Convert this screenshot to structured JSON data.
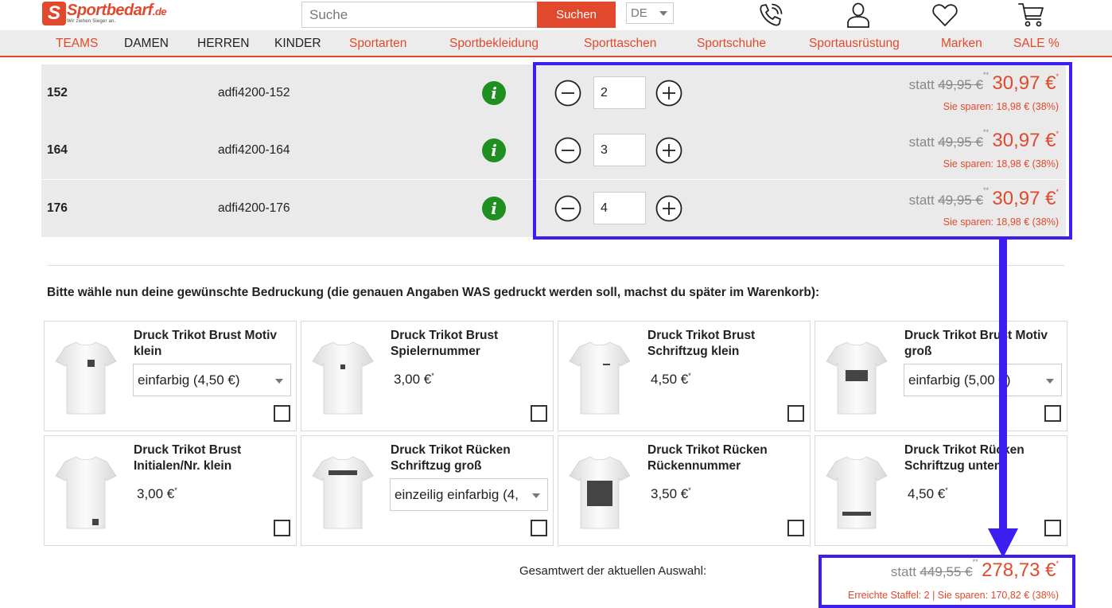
{
  "header": {
    "logo": {
      "name": "Sportbedarf",
      "tld": ".de",
      "slogan": "Wir ziehen Sieger an."
    },
    "search": {
      "placeholder": "Suche",
      "button": "Suchen"
    },
    "language": "DE",
    "icons": [
      "phone-icon",
      "user-icon",
      "heart-icon",
      "cart-icon"
    ]
  },
  "nav": [
    {
      "label": "TEAMS",
      "style": "red"
    },
    {
      "label": "DAMEN",
      "style": "dark"
    },
    {
      "label": "HERREN",
      "style": "dark"
    },
    {
      "label": "KINDER",
      "style": "dark"
    },
    {
      "label": "Sportarten",
      "style": "red"
    },
    {
      "label": "Sportbekleidung",
      "style": "red"
    },
    {
      "label": "Sporttaschen",
      "style": "red"
    },
    {
      "label": "Sportschuhe",
      "style": "red"
    },
    {
      "label": "Sportausrüstung",
      "style": "red"
    },
    {
      "label": "Marken",
      "style": "red"
    },
    {
      "label": "SALE %",
      "style": "red"
    }
  ],
  "sizes": [
    {
      "size": "152",
      "sku": "adfi4200-152",
      "qty": "2",
      "statt": "statt",
      "old_price": "49,95 €",
      "old_sup": "**",
      "new_price": "30,97 €",
      "new_sup": "*",
      "save": "Sie sparen: 18,98 € (38%)"
    },
    {
      "size": "164",
      "sku": "adfi4200-164",
      "qty": "3",
      "statt": "statt",
      "old_price": "49,95 €",
      "old_sup": "**",
      "new_price": "30,97 €",
      "new_sup": "*",
      "save": "Sie sparen: 18,98 € (38%)"
    },
    {
      "size": "176",
      "sku": "adfi4200-176",
      "qty": "4",
      "statt": "statt",
      "old_price": "49,95 €",
      "old_sup": "**",
      "new_price": "30,97 €",
      "new_sup": "*",
      "save": "Sie sparen: 18,98 € (38%)"
    }
  ],
  "print_section": {
    "title": "Bitte wähle nun deine gewünschte Bedruckung (die genauen Angaben WAS gedruckt werden soll, machst du später im Warenkorb):"
  },
  "print_options": [
    {
      "title": "Druck Trikot Brust Motiv klein",
      "select": "einfarbig (4,50 €)",
      "price": "",
      "mark": "chest-small"
    },
    {
      "title": "Druck Trikot Brust Spielernummer",
      "select": "",
      "price": "3,00 €",
      "mark": "chest-number"
    },
    {
      "title": "Druck Trikot Brust Schriftzug klein",
      "select": "",
      "price": "4,50 €",
      "mark": "chest-text"
    },
    {
      "title": "Druck Trikot Brust Motiv groß",
      "select": "einfarbig (5,00 €)",
      "price": "",
      "mark": "chest-large"
    },
    {
      "title": "Druck Trikot Brust Initialen/Nr. klein",
      "select": "",
      "price": "3,00 €",
      "mark": "bottom-small"
    },
    {
      "title": "Druck Trikot Rücken Schriftzug groß",
      "select": "einzeilig einfarbig (4,",
      "price": "",
      "mark": "back-top-bar"
    },
    {
      "title": "Druck Trikot Rücken Rückennummer",
      "select": "",
      "price": "3,50 €",
      "mark": "back-big"
    },
    {
      "title": "Druck Trikot Rücken Schriftzug unten",
      "select": "",
      "price": "4,50 €",
      "mark": "back-bottom-bar"
    }
  ],
  "price_sup": "*",
  "total": {
    "label": "Gesamtwert der aktuellen Auswahl:",
    "statt": "statt",
    "old_price": "449,55 €",
    "old_sup": "**",
    "new_price": "278,73 €",
    "new_sup": "*",
    "save": "Erreichte Staffel: 2 | Sie sparen: 170,82 € (38%)"
  },
  "colors": {
    "brand": "#e2492c",
    "annotation": "#3d1ef0",
    "info": "#1f8f1f"
  }
}
